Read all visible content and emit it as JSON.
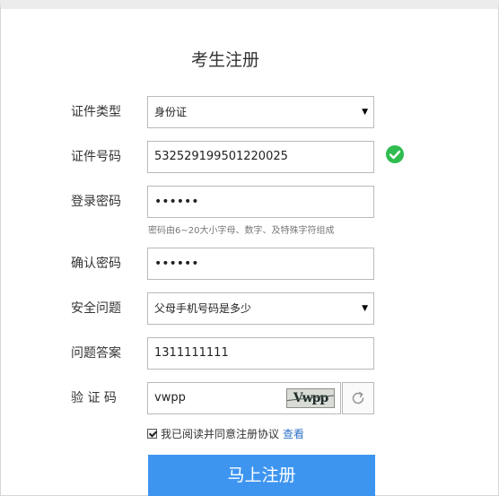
{
  "page": {
    "title": "考生注册"
  },
  "form": {
    "id_type": {
      "label": "证件类型",
      "value": "身份证"
    },
    "id_number": {
      "label": "证件号码",
      "value": "532529199501220025"
    },
    "password": {
      "label": "登录密码",
      "value": "••••••",
      "hint": "密码由6~20大小字母、数字、及特殊字符组成"
    },
    "confirm_password": {
      "label": "确认密码",
      "value": "••••••"
    },
    "security_question": {
      "label": "安全问题",
      "value": "父母手机号码是多少"
    },
    "answer": {
      "label": "问题答案",
      "value": "1311111111"
    },
    "captcha": {
      "label": "验 证 码",
      "value": "vwpp",
      "image_text": "Vwpp"
    },
    "agreement": {
      "text": "我已阅读并同意注册协议",
      "link": "查看",
      "checked": true
    },
    "submit_label": "马上注册"
  },
  "colors": {
    "primary": "#3e95f0",
    "success": "#2ebc4f",
    "link": "#2f72c8"
  },
  "icons": {
    "valid": "check-circle-icon",
    "refresh": "refresh-icon",
    "dropdown": "caret-down-icon"
  }
}
